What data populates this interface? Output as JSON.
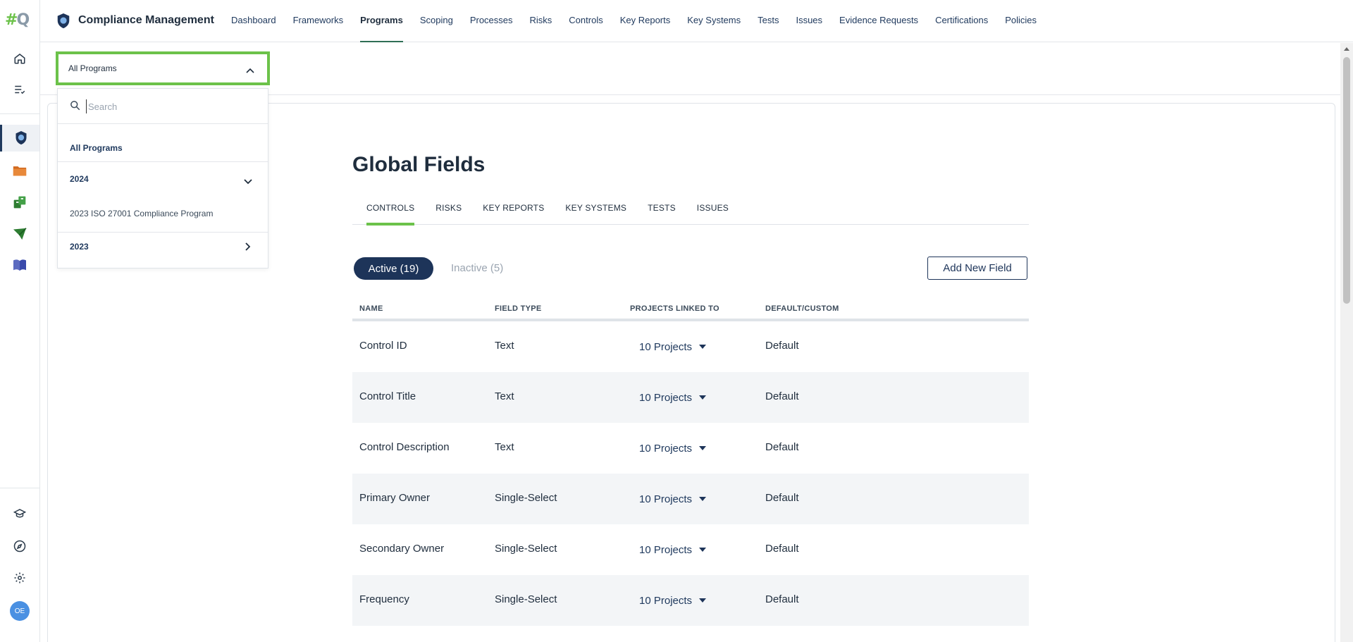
{
  "brand": {
    "logo_text": "#Q"
  },
  "app": {
    "title": "Compliance Management"
  },
  "nav": {
    "items": [
      "Dashboard",
      "Frameworks",
      "Programs",
      "Scoping",
      "Processes",
      "Risks",
      "Controls",
      "Key Reports",
      "Key Systems",
      "Tests",
      "Issues",
      "Evidence Requests",
      "Certifications",
      "Policies"
    ],
    "active": "Programs"
  },
  "rail": {
    "icons": [
      "home-icon",
      "checklist-icon",
      "compliance-badge-icon",
      "folder-icon",
      "sync-docs-icon",
      "send-icon",
      "book-icon",
      "learn-icon",
      "compass-icon",
      "gear-icon"
    ],
    "avatar_initials": "OE"
  },
  "program_selector": {
    "value": "All Programs",
    "search_placeholder": "Search",
    "all_label": "All Programs",
    "groups": [
      {
        "year": "2024",
        "expanded": true,
        "items": [
          "2023 ISO 27001 Compliance Program"
        ]
      },
      {
        "year": "2023",
        "expanded": false,
        "items": []
      }
    ]
  },
  "page": {
    "title": "Global Fields"
  },
  "tabs": {
    "items": [
      "CONTROLS",
      "RISKS",
      "KEY REPORTS",
      "KEY SYSTEMS",
      "TESTS",
      "ISSUES"
    ],
    "active": "CONTROLS"
  },
  "filters": {
    "active_label": "Active (19)",
    "inactive_label": "Inactive (5)"
  },
  "actions": {
    "add_label": "Add New Field"
  },
  "table": {
    "headers": [
      "NAME",
      "FIELD TYPE",
      "PROJECTS LINKED TO",
      "DEFAULT/CUSTOM"
    ],
    "rows": [
      {
        "name": "Control ID",
        "type": "Text",
        "projects": "10 Projects",
        "kind": "Default"
      },
      {
        "name": "Control Title",
        "type": "Text",
        "projects": "10 Projects",
        "kind": "Default"
      },
      {
        "name": "Control Description",
        "type": "Text",
        "projects": "10 Projects",
        "kind": "Default"
      },
      {
        "name": "Primary Owner",
        "type": "Single-Select",
        "projects": "10 Projects",
        "kind": "Default"
      },
      {
        "name": "Secondary Owner",
        "type": "Single-Select",
        "projects": "10 Projects",
        "kind": "Default"
      },
      {
        "name": "Frequency",
        "type": "Single-Select",
        "projects": "10 Projects",
        "kind": "Default"
      }
    ]
  },
  "colors": {
    "accent_green": "#6cc24a",
    "navy": "#1d3459",
    "link": "#203a5e"
  }
}
